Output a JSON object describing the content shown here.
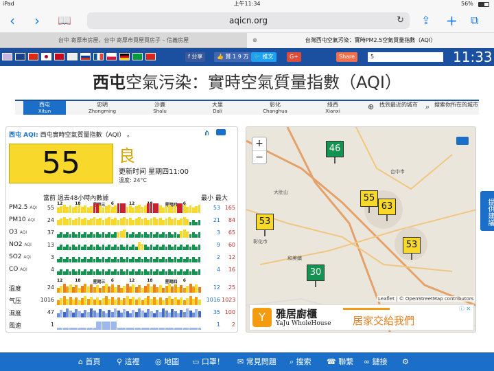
{
  "status": {
    "device": "iPad",
    "time": "上午11:34",
    "battery": "56%"
  },
  "browser": {
    "url": "aqicn.org"
  },
  "tabs": [
    {
      "label": "台中 寄厚市房屋、台中 寄厚市買屋買房子 – 信義房屋",
      "active": false
    },
    {
      "label": "台灣西屯空氣污染：實時PM2.5空氣質量指數（AQI）",
      "active": true
    }
  ],
  "sitebar": {
    "share": "分享",
    "like": "贊 1.9 万",
    "tweet": "推文",
    "gplus": "G+",
    "share_count": "5",
    "clock": "11:33"
  },
  "page_title_bold": "西屯",
  "page_title_rest": "空氣污染：實時空氣質量指數（AQI）",
  "stations": [
    {
      "name": "西屯",
      "en": "Xitun",
      "active": true
    },
    {
      "name": "忠明",
      "en": "Zhongming",
      "active": false
    },
    {
      "name": "沙鹿",
      "en": "Shalu",
      "active": false
    },
    {
      "name": "大里",
      "en": "Dali",
      "active": false
    },
    {
      "name": "彰化",
      "en": "Changhua",
      "active": false
    },
    {
      "name": "綠西",
      "en": "Xianxi",
      "active": false
    },
    {
      "name": "找到最近的城市",
      "en": "",
      "active": false
    },
    {
      "name": "搜索你所在的城市",
      "en": "",
      "active": false
    }
  ],
  "panel": {
    "header_station": "西屯 AQI:",
    "header_text": "西屯實時空氣質量指數（AQI） 。",
    "aqi": "55",
    "level": "良",
    "updated": "更新时间 星期四11:00",
    "temp": "溫度: 24°C",
    "table_title": "當前 過去48小時內數據",
    "minmax": "最小 最大",
    "hours1": [
      "12",
      "18",
      "星期三",
      "6",
      "12",
      "18",
      "星期四",
      "6"
    ],
    "hours2": [
      "12",
      "18",
      "星期三",
      "6",
      "12",
      "18",
      "星期四",
      "6"
    ]
  },
  "rows": [
    {
      "label": "PM2.5",
      "unit": "AQI",
      "cur": "55",
      "min": "53",
      "max": "165"
    },
    {
      "label": "PM10",
      "unit": "AQI",
      "cur": "24",
      "min": "21",
      "max": "84"
    },
    {
      "label": "O3",
      "unit": "AQI",
      "cur": "37",
      "min": "3",
      "max": "65"
    },
    {
      "label": "NO2",
      "unit": "AQI",
      "cur": "13",
      "min": "9",
      "max": "60"
    },
    {
      "label": "SO2",
      "unit": "AQI",
      "cur": "3",
      "min": "2",
      "max": "12"
    },
    {
      "label": "CO",
      "unit": "AQI",
      "cur": "4",
      "min": "4",
      "max": "16"
    },
    {
      "label": "溫度",
      "unit": "",
      "cur": "24",
      "min": "12",
      "max": "25"
    },
    {
      "label": "气压",
      "unit": "",
      "cur": "1016",
      "min": "1016",
      "max": "1023"
    },
    {
      "label": "濕度",
      "unit": "",
      "cur": "47",
      "min": "35",
      "max": "100"
    },
    {
      "label": "風速",
      "unit": "",
      "cur": "1",
      "min": "1",
      "max": "2"
    }
  ],
  "map": {
    "zoom_in": "+",
    "zoom_out": "−",
    "attribution": "Leaflet | © OpenStreetMap contributors",
    "markers": [
      {
        "value": "46",
        "color": "#13934f"
      },
      {
        "value": "55",
        "color": "#f7d82b"
      },
      {
        "value": "63",
        "color": "#f7d82b"
      },
      {
        "value": "53",
        "color": "#f7d82b"
      },
      {
        "value": "53",
        "color": "#f7d82b"
      },
      {
        "value": "30",
        "color": "#13934f"
      }
    ],
    "places": [
      "大肚山",
      "和美鎮",
      "彰化市",
      "台中市"
    ]
  },
  "ad": {
    "brand": "雅居廚櫃",
    "brand_en": "YaJu WholeHouse",
    "slogan": "居家交給我們"
  },
  "sidetab": "提供建議",
  "bottomnav": [
    "首頁",
    "這裡",
    "地圖",
    "口罩！",
    "常見問題",
    "搜索",
    "聯繫",
    "鏈接"
  ],
  "colors": {
    "good": "#13934f",
    "moderate": "#f7d82b",
    "usg": "#f39c12",
    "unhealthy": "#cc1f2f",
    "brand_blue": "#1b6fc8"
  },
  "sparkline_levels": {
    "pm25": [
      "m",
      "m",
      "m",
      "m",
      "m",
      "m",
      "m",
      "m",
      "m",
      "m",
      "m",
      "m",
      "u",
      "u",
      "m",
      "m",
      "m",
      "m",
      "m",
      "m",
      "u",
      "u",
      "u",
      "m",
      "m",
      "m",
      "m",
      "m",
      "m",
      "m",
      "u",
      "u",
      "u",
      "u",
      "m",
      "m",
      "m",
      "m",
      "m",
      "m",
      "u",
      "u",
      "m",
      "m",
      "m",
      "m",
      "m",
      "m"
    ],
    "pm10": [
      "m",
      "m",
      "m",
      "m",
      "m",
      "m",
      "m",
      "m",
      "m",
      "m",
      "m",
      "m",
      "m",
      "m",
      "m",
      "m",
      "m",
      "m",
      "m",
      "m",
      "m",
      "m",
      "m",
      "m",
      "m",
      "m",
      "m",
      "m",
      "m",
      "m",
      "m",
      "m",
      "m",
      "m",
      "m",
      "m",
      "m",
      "m",
      "m",
      "m",
      "m",
      "m",
      "m",
      "m",
      "g",
      "g",
      "g",
      "g"
    ],
    "o3": [
      "g",
      "g",
      "g",
      "g",
      "g",
      "g",
      "g",
      "g",
      "g",
      "g",
      "g",
      "g",
      "g",
      "g",
      "g",
      "g",
      "g",
      "g",
      "g",
      "g",
      "m",
      "m",
      "m",
      "g",
      "g",
      "g",
      "g",
      "g",
      "g",
      "g",
      "g",
      "g",
      "g",
      "g",
      "g",
      "g",
      "g",
      "g",
      "g",
      "g",
      "g",
      "m",
      "m",
      "m",
      "g",
      "g",
      "g",
      "g"
    ],
    "no2": [
      "g",
      "g",
      "g",
      "g",
      "g",
      "g",
      "g",
      "g",
      "g",
      "g",
      "g",
      "g",
      "g",
      "g",
      "g",
      "g",
      "g",
      "g",
      "g",
      "g",
      "g",
      "g",
      "g",
      "g",
      "g",
      "g",
      "g",
      "m",
      "m",
      "g",
      "g",
      "g",
      "g",
      "g",
      "g",
      "g",
      "g",
      "g",
      "g",
      "g",
      "g",
      "g",
      "g",
      "g",
      "g",
      "g",
      "g",
      "g"
    ],
    "so2": [
      "g",
      "g",
      "g",
      "g",
      "g",
      "g",
      "g",
      "g",
      "g",
      "g",
      "g",
      "g",
      "g",
      "g",
      "g",
      "g",
      "g",
      "g",
      "g",
      "g",
      "g",
      "g",
      "g",
      "g",
      "g",
      "g",
      "g",
      "g",
      "g",
      "g",
      "g",
      "g",
      "g",
      "g",
      "g",
      "g",
      "g",
      "g",
      "g",
      "g",
      "g",
      "g",
      "g",
      "g",
      "g",
      "g",
      "g",
      "g"
    ],
    "co": [
      "g",
      "g",
      "g",
      "g",
      "g",
      "g",
      "g",
      "g",
      "g",
      "g",
      "g",
      "g",
      "g",
      "g",
      "g",
      "g",
      "g",
      "g",
      "g",
      "g",
      "g",
      "g",
      "g",
      "g",
      "g",
      "g",
      "g",
      "g",
      "g",
      "g",
      "g",
      "g",
      "g",
      "g",
      "g",
      "g",
      "g",
      "g",
      "g",
      "g",
      "g",
      "g",
      "g",
      "g",
      "g",
      "g",
      "g",
      "g"
    ]
  }
}
